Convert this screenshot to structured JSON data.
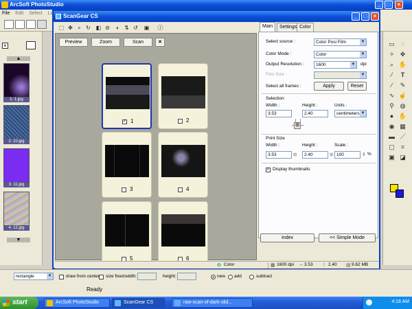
{
  "app": {
    "title": "ArcSoft PhotoStudio",
    "menu": [
      "File",
      "Edit",
      "Select",
      "Lay"
    ]
  },
  "left_panel": {
    "thumbnails": [
      {
        "caption": "1. 1.jpg",
        "color": "#2a0a3a"
      },
      {
        "caption": "2. 10.jpg",
        "color": "#3e5a8c"
      },
      {
        "caption": "3. 11.jpg",
        "color": "#7a2cf0"
      },
      {
        "caption": "4. 12.jpg",
        "color": "#b8a8c8"
      }
    ]
  },
  "scangear": {
    "title": "ScanGear CS",
    "preview_buttons": {
      "preview": "Preview",
      "zoom": "Zoom",
      "scan": "Scan",
      "clear": "✕"
    },
    "frames": [
      {
        "num": "1",
        "checked": "✓"
      },
      {
        "num": "2",
        "checked": ""
      },
      {
        "num": "3",
        "checked": ""
      },
      {
        "num": "4",
        "checked": ""
      },
      {
        "num": "5",
        "checked": ""
      },
      {
        "num": "6",
        "checked": ""
      }
    ],
    "tabs": [
      "Main",
      "Settings",
      "Color"
    ],
    "main": {
      "select_source_label": "Select source :",
      "select_source_value": "Color Posi Film",
      "color_mode_label": "Color Mode :",
      "color_mode_value": "Color",
      "output_resolution_label": "Output Resolution :",
      "output_resolution_value": "1600",
      "dpi_unit": "dpi",
      "film_size_label": "Film Size :",
      "select_all_label": "Select all frames :",
      "apply": "Apply",
      "reset": "Reset",
      "selection_header": "Selection",
      "width_label": "Width :",
      "height_label": "Height :",
      "units_label": "Units :",
      "sel_width": "3.53",
      "sel_height": "2.40",
      "units_value": "centimeters",
      "print_size_header": "Print Size",
      "ps_width_label": "Width :",
      "ps_height_label": "Height :",
      "scale_label": "Scale :",
      "ps_width": "3.53",
      "ps_height": "2.40",
      "scale": "100",
      "percent": "%",
      "display_thumbnails": "Display thumbnails",
      "index": "Index",
      "simple_mode": "<< Simple Mode"
    },
    "status": {
      "mode": "Color",
      "dpi": "1600 dpi",
      "width": "3.53",
      "height": "2.40",
      "size": "9.62 MB"
    }
  },
  "option_bar": {
    "shape": "rectangle",
    "draw_from_center": "draw from center",
    "size_fixed": "size fixed",
    "width_label": "width:",
    "height_label": "height:",
    "new": "new",
    "add": "add",
    "subtract": "subtract"
  },
  "status_bar": {
    "ready": "Ready"
  },
  "taskbar": {
    "start": "start",
    "tasks": [
      "ArcSoft PhotoStudio",
      "ScanGear CS",
      "raw-scan-of-dark-slid..."
    ],
    "clock": "4:18 AM"
  }
}
